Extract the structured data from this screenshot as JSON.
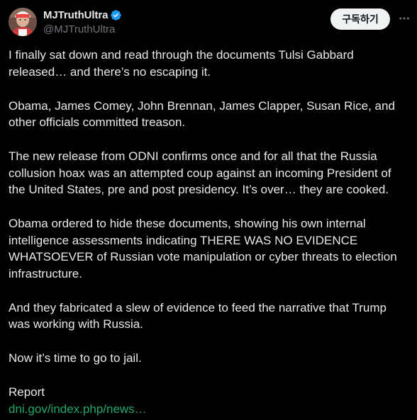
{
  "author": {
    "display_name": "MJTruthUltra",
    "handle": "@MJTruthUltra",
    "verified_color": "#1d9bf0"
  },
  "actions": {
    "subscribe_label": "구독하기"
  },
  "tweet": {
    "paragraphs": [
      "I finally sat down and read through the documents Tulsi Gabbard released… and there’s no escaping it.",
      "Obama, James Comey, John Brennan, James Clapper, Susan Rice, and other officials committed treason.",
      "The new release from ODNI confirms once and for all that the Russia collusion hoax was an attempted coup against an incoming President of the United States, pre and post presidency. It’s over… they are cooked.",
      "Obama ordered to hide these documents, showing his own internal intelligence assessments indicating THERE WAS NO EVIDENCE WHATSOEVER of Russian vote manipulation or cyber threats to election infrastructure.",
      "And they fabricated a slew of evidence to feed the narrative that Trump was working with Russia.",
      "Now it’s time to go to jail."
    ],
    "report_label": "Report",
    "link_text": "dni.gov/index.php/news…",
    "link_color": "#23a86b"
  }
}
